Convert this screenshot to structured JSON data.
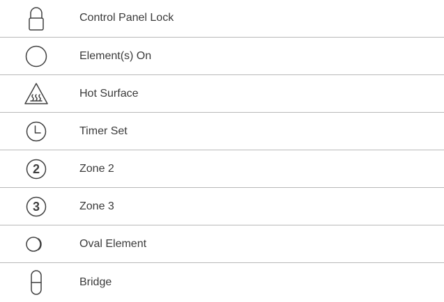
{
  "items": [
    {
      "icon": "lock-icon",
      "label": "Control Panel Lock"
    },
    {
      "icon": "circle-icon",
      "label": "Element(s) On"
    },
    {
      "icon": "hot-surface-icon",
      "label": "Hot Surface"
    },
    {
      "icon": "clock-icon",
      "label": "Timer Set"
    },
    {
      "icon": "zone-2-icon",
      "label": "Zone 2",
      "digit": "2"
    },
    {
      "icon": "zone-3-icon",
      "label": "Zone 3",
      "digit": "3"
    },
    {
      "icon": "oval-element-icon",
      "label": "Oval Element"
    },
    {
      "icon": "bridge-icon",
      "label": "Bridge"
    }
  ],
  "colors": {
    "text": "#3a3a3a",
    "icon": "#3f3f3f",
    "divider": "#b8b8b8"
  }
}
